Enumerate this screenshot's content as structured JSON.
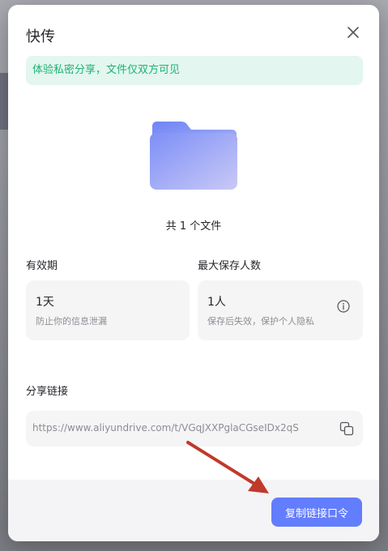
{
  "dialog": {
    "title": "快传",
    "notice": "体验私密分享，文件仅双方可见",
    "file_count": "共 1 个文件"
  },
  "validity": {
    "label": "有效期",
    "value": "1天",
    "hint": "防止你的信息泄漏"
  },
  "max_savers": {
    "label": "最大保存人数",
    "value": "1人",
    "hint": "保存后失效，保护个人隐私"
  },
  "share_link": {
    "label": "分享链接",
    "url": "https://www.aliyundrive.com/t/VGqJXXPglaCGseIDx2qS"
  },
  "footer": {
    "copy_button_label": "复制链接口令"
  },
  "icons": {
    "close": "close-icon",
    "folder": "folder-icon",
    "info": "info-icon",
    "copy": "copy-icon"
  },
  "colors": {
    "accent": "#637dff",
    "notice_bg": "#e3f6ef",
    "notice_text": "#1cb373",
    "annotation_arrow": "#c0392b"
  }
}
